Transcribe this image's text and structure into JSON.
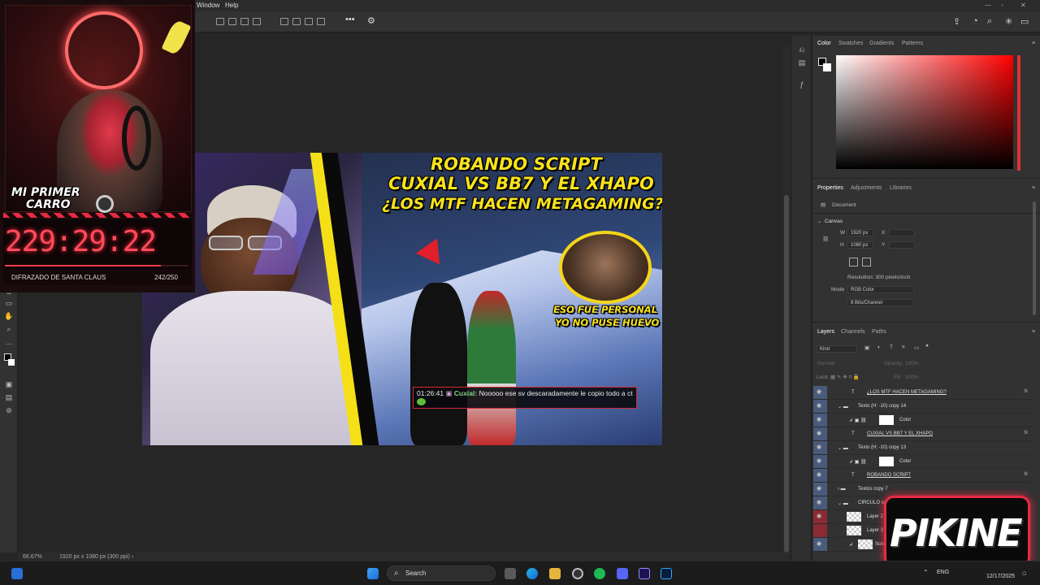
{
  "menubar": {
    "items": [
      "Window",
      "Help"
    ]
  },
  "photoshop": {
    "status": {
      "zoom": "66.67%",
      "doc_info": "1920 px x 1080 px (300 ppi)"
    },
    "color_tabs": [
      "Color",
      "Swatches",
      "Gradients",
      "Patterns"
    ],
    "properties_tabs": [
      "Properties",
      "Adjustments",
      "Libraries"
    ],
    "properties": {
      "document_label": "Document",
      "canvas_label": "Canvas",
      "w_label": "W",
      "w_value": "1920 px",
      "h_label": "H",
      "h_value": "1080 px",
      "x_label": "X",
      "y_label": "Y",
      "resolution": "Resolution: 300 pixels/inch",
      "mode_label": "Mode",
      "mode_value": "RGB Color",
      "bits_value": "8 Bits/Channel"
    },
    "layers_tabs": [
      "Layers",
      "Channels",
      "Paths"
    ],
    "layers_filter": "Kind",
    "blend_mode": "Normal",
    "opacity_label": "Opacity:",
    "opacity_value": "100%",
    "lock_label": "Lock:",
    "fill_label": "Fill:",
    "fill_value": "100%",
    "layers": [
      {
        "name": "¿LOS MTF HACEN METAGAMING?",
        "kind": "text",
        "fx": true,
        "indent": 0
      },
      {
        "name": "Texto (H: -10) copy 14",
        "kind": "group",
        "fx": false,
        "indent": 0
      },
      {
        "name": "Color",
        "kind": "fill",
        "fx": false,
        "indent": 1
      },
      {
        "name": "CUXIAL VS BB7 Y EL XHAPO",
        "kind": "text",
        "fx": true,
        "indent": 0
      },
      {
        "name": "Texto (H: -10) copy 13",
        "kind": "group",
        "fx": false,
        "indent": 0
      },
      {
        "name": "Color",
        "kind": "fill",
        "fx": false,
        "indent": 1
      },
      {
        "name": "ROBANDO SCRIPT",
        "kind": "text",
        "fx": true,
        "indent": 0
      },
      {
        "name": "Textos copy 7",
        "kind": "group",
        "fx": false,
        "indent": 0
      },
      {
        "name": "CIRCULO co",
        "kind": "group",
        "fx": false,
        "indent": 0
      },
      {
        "name": "Layer 2",
        "kind": "pixel",
        "fx": false,
        "indent": 1
      },
      {
        "name": "Layer 3",
        "kind": "pixel",
        "fx": false,
        "indent": 1
      },
      {
        "name": "Scre",
        "kind": "pixel",
        "fx": false,
        "indent": 1
      }
    ]
  },
  "thumbnail": {
    "title_line1": "ROBANDO SCRIPT",
    "title_line2": "CUXIAL VS BB7 Y EL XHAPO",
    "title_line3": "¿LOS MTF HACEN METAGAMING?",
    "caption_line1": "ESO FUE PERSONAL",
    "caption_line2": "YO NO PUSE HUEVO",
    "chat_time": "01:26:41",
    "chat_user": "Cuxial:",
    "chat_message": "Nooooo ese sv descaradamente le copio todo a ct"
  },
  "webcam": {
    "alert_line1": "MI PRIMER",
    "alert_line2": "CARRO",
    "timer": "229:29:22",
    "goal_label": "DIFRAZADO DE SANTA CLAUS",
    "goal_count": "242/250",
    "goal_progress": 0.85
  },
  "watermark": {
    "text": "PIKINE"
  },
  "taskbar": {
    "search_label": "Search",
    "lang": "ENG",
    "date": "12/17/2025"
  },
  "colors": {
    "accent_red": "#e82a44",
    "title_yellow": "#f8e21c",
    "ps_panel": "#323232"
  }
}
